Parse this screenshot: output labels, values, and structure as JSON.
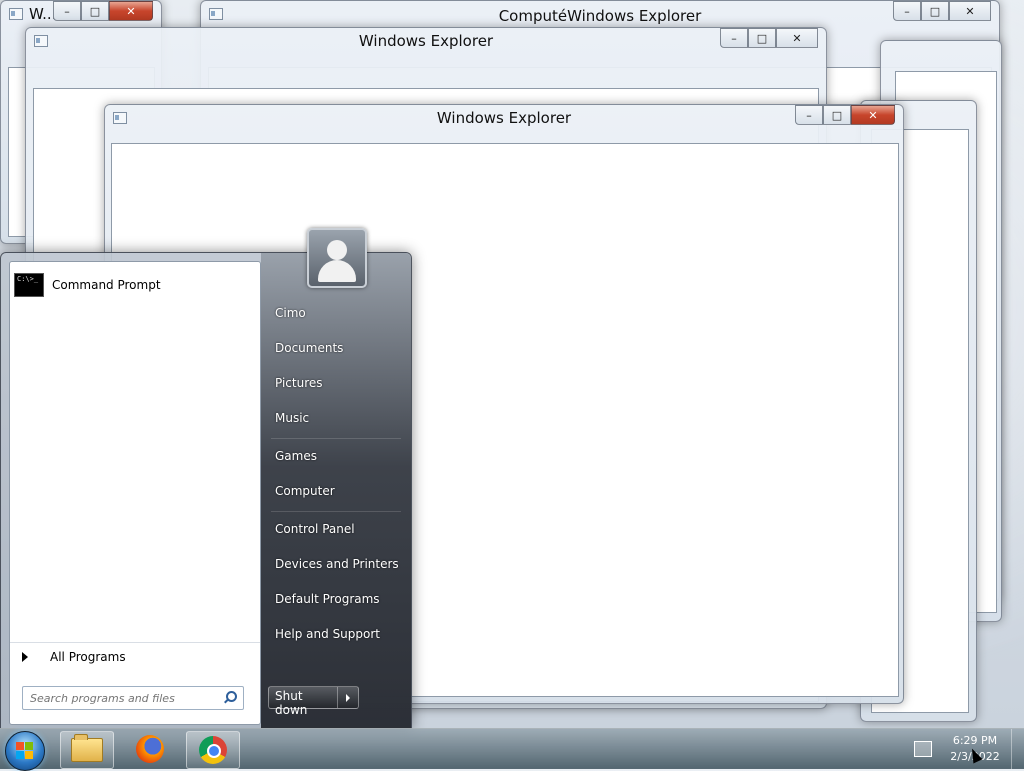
{
  "windows": [
    {
      "title": "W...",
      "id": "far-left"
    },
    {
      "title": "ComputéWindows Explorer",
      "id": "back-top"
    },
    {
      "title": "Windows Explorer",
      "id": "middle"
    },
    {
      "title": "Windows Explorer",
      "id": "front"
    }
  ],
  "window_controls": {
    "minimize": "–",
    "maximize": "□",
    "close": "✕"
  },
  "start_menu": {
    "pinned_programs": [
      {
        "label": "Command Prompt",
        "icon": "command-prompt-icon",
        "icon_text": "C:\\>_"
      }
    ],
    "all_programs_label": "All Programs",
    "search_placeholder": "Search programs and files",
    "right_items": [
      "Cimo",
      "Documents",
      "Pictures",
      "Music",
      "Games",
      "Computer",
      "Control Panel",
      "Devices and Printers",
      "Default Programs",
      "Help and Support"
    ],
    "shutdown_label": "Shut down"
  },
  "taskbar": {
    "pinned": [
      {
        "name": "windows-explorer",
        "icon": "folder-icon"
      },
      {
        "name": "firefox",
        "icon": "firefox-icon"
      },
      {
        "name": "chrome",
        "icon": "chrome-icon"
      }
    ],
    "clock_time": "6:29 PM",
    "clock_date": "2/3/2022"
  },
  "colors": {
    "close_button": "#c7452c",
    "accent": "#2c79c6",
    "start_menu_right": "#2a2e36"
  }
}
